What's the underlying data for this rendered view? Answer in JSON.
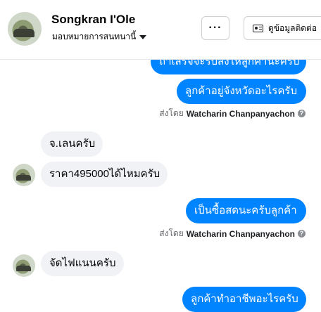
{
  "header": {
    "name": "Songkran I'Ole",
    "subtitle": "มอบหมายการสนทนานี้",
    "more_label": "···",
    "contact_label": "ดูข้อมูลติดต่อ"
  },
  "messages": [
    {
      "dir": "out",
      "text": "ถ้าเสร็จจะรีบส่งให้ลูกค้านะครับ"
    },
    {
      "dir": "out",
      "text": "ลูกค้าอยู่จังหวัดอะไรครับ"
    },
    {
      "dir": "in",
      "text": "จ.เลนครับ"
    },
    {
      "dir": "in",
      "text": "ราคา495000ได้ไหมครับ"
    },
    {
      "dir": "out",
      "text": "เป็นซื้อสดนะครับลูกค้า"
    },
    {
      "dir": "in",
      "text": "จัดไฟแนนครับ"
    },
    {
      "dir": "out",
      "text": "ลูกค้าทำอาชีพอะไรครับ"
    }
  ],
  "sent_by": {
    "prefix": "ส่งโดย",
    "agent": "Watcharin Chanpanyachon",
    "info_icon": "question-circle-icon"
  }
}
